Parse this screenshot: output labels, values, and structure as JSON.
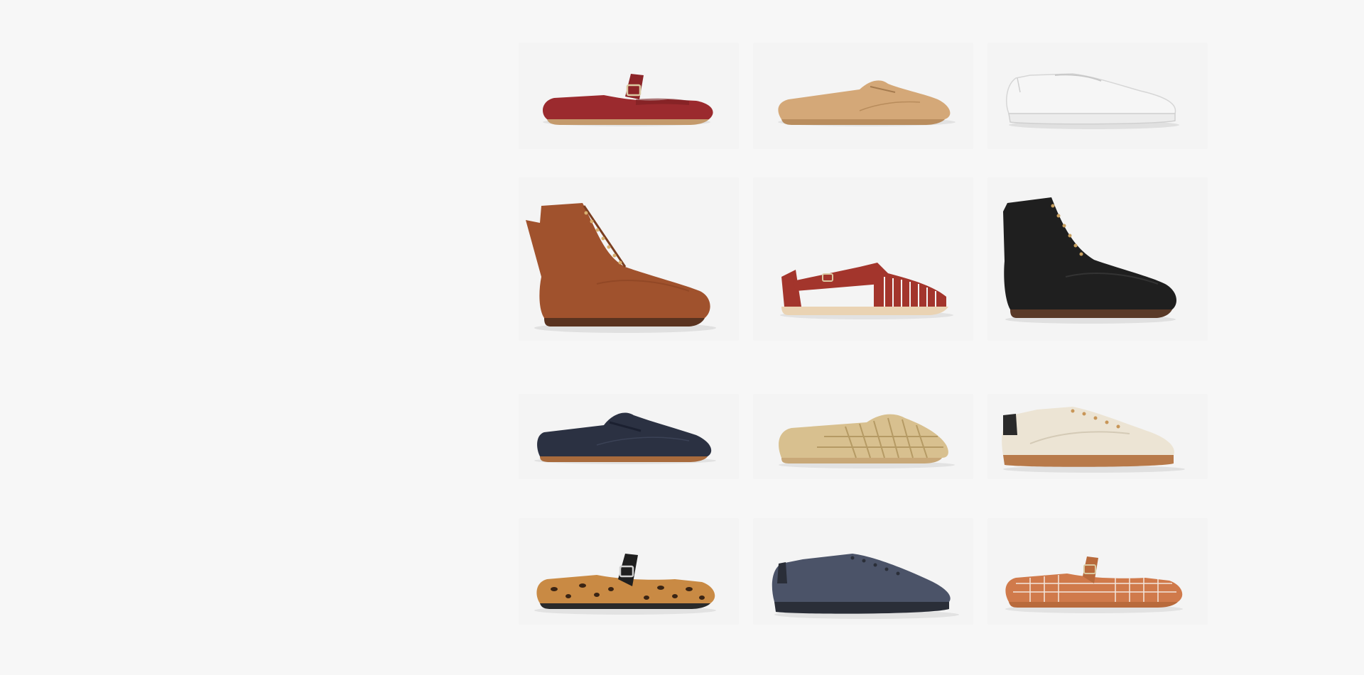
{
  "products": [
    {
      "name": "red-mary-jane-flat",
      "color": "#9b2a2e"
    },
    {
      "name": "tan-suede-lace-up",
      "color": "#d4a878"
    },
    {
      "name": "white-leather-sneaker",
      "color": "#f4f4f4"
    },
    {
      "name": "brown-leather-lace-up-boot",
      "color": "#a0522d"
    },
    {
      "name": "red-woven-sandal",
      "color": "#a3352c"
    },
    {
      "name": "black-leather-lace-up-boot",
      "color": "#1f1f1f"
    },
    {
      "name": "navy-leather-derby",
      "color": "#2b3142"
    },
    {
      "name": "gold-woven-huarache",
      "color": "#d8c08f"
    },
    {
      "name": "cream-lace-sneaker",
      "color": "#ece4d4"
    },
    {
      "name": "leopard-mary-jane-flat",
      "color": "#c98a44"
    },
    {
      "name": "navy-canvas-sneaker",
      "color": "#4b5368"
    },
    {
      "name": "tan-woven-mary-jane",
      "color": "#d07a4b"
    }
  ]
}
